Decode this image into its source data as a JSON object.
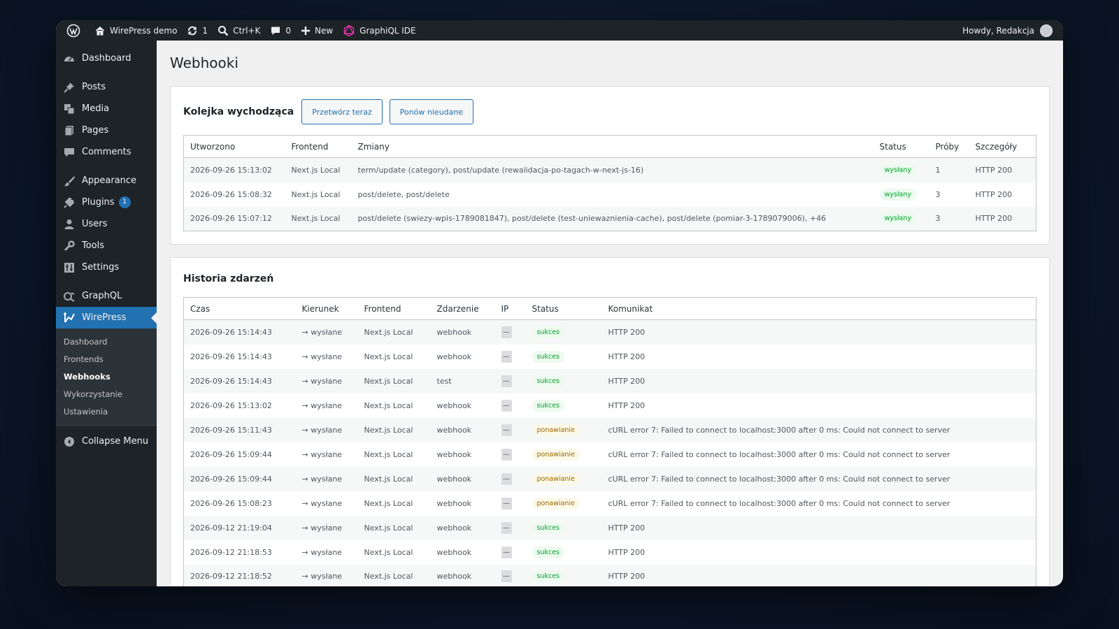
{
  "adminbar": {
    "site_name": "WirePress demo",
    "updates_count": "1",
    "search_shortcut": "Ctrl+K",
    "comments_count": "0",
    "new_label": "New",
    "graphiql_label": "GraphiQL IDE",
    "howdy": "Howdy, Redakcja"
  },
  "sidebar": {
    "items": [
      {
        "label": "Dashboard",
        "icon": "dashboard-icon"
      },
      {
        "label": "Posts",
        "icon": "pin-icon"
      },
      {
        "label": "Media",
        "icon": "media-icon"
      },
      {
        "label": "Pages",
        "icon": "pages-icon"
      },
      {
        "label": "Comments",
        "icon": "comment-icon"
      },
      {
        "label": "Appearance",
        "icon": "brush-icon"
      },
      {
        "label": "Plugins",
        "icon": "plugin-icon",
        "badge": "1"
      },
      {
        "label": "Users",
        "icon": "user-icon"
      },
      {
        "label": "Tools",
        "icon": "wrench-icon"
      },
      {
        "label": "Settings",
        "icon": "settings-icon"
      },
      {
        "label": "GraphQL",
        "icon": "graphql-icon"
      },
      {
        "label": "WirePress",
        "icon": "wirepress-icon"
      }
    ],
    "submenu": [
      "Dashboard",
      "Frontends",
      "Webhooks",
      "Wykorzystanie",
      "Ustawienia"
    ],
    "collapse_label": "Collapse Menu"
  },
  "page": {
    "title": "Webhooki"
  },
  "queue": {
    "title": "Kolejka wychodząca",
    "btn_process": "Przetwórz teraz",
    "btn_retry": "Ponów nieudane",
    "headers": [
      "Utworzono",
      "Frontend",
      "Zmiany",
      "Status",
      "Próby",
      "Szczegóły"
    ],
    "rows": [
      [
        "2026-09-26 15:13:02",
        "Next.js Local",
        "term/update (category), post/update (rewalidacja-po-tagach-w-next-js-16)",
        "wysłany",
        "1",
        "HTTP 200"
      ],
      [
        "2026-09-26 15:08:32",
        "Next.js Local",
        "post/delete, post/delete",
        "wysłany",
        "3",
        "HTTP 200"
      ],
      [
        "2026-09-26 15:07:12",
        "Next.js Local",
        "post/delete (swiezy-wpis-1789081847), post/delete (test-uniewaznienia-cache), post/delete (pomiar-3-1789079006), +46",
        "wysłany",
        "3",
        "HTTP 200"
      ]
    ]
  },
  "history": {
    "title": "Historia zdarzeń",
    "headers": [
      "Czas",
      "Kierunek",
      "Frontend",
      "Zdarzenie",
      "IP",
      "Status",
      "Komunikat"
    ],
    "rows": [
      [
        "2026-09-26 15:14:43",
        "→ wysłane",
        "Next.js Local",
        "webhook",
        "—",
        "sukces",
        "HTTP 200"
      ],
      [
        "2026-09-26 15:14:43",
        "→ wysłane",
        "Next.js Local",
        "webhook",
        "—",
        "sukces",
        "HTTP 200"
      ],
      [
        "2026-09-26 15:14:43",
        "→ wysłane",
        "Next.js Local",
        "test",
        "—",
        "sukces",
        "HTTP 200"
      ],
      [
        "2026-09-26 15:13:02",
        "→ wysłane",
        "Next.js Local",
        "webhook",
        "—",
        "sukces",
        "HTTP 200"
      ],
      [
        "2026-09-26 15:11:43",
        "→ wysłane",
        "Next.js Local",
        "webhook",
        "—",
        "ponawianie",
        "cURL error 7: Failed to connect to localhost:3000 after 0 ms: Could not connect to server"
      ],
      [
        "2026-09-26 15:09:44",
        "→ wysłane",
        "Next.js Local",
        "webhook",
        "—",
        "ponawianie",
        "cURL error 7: Failed to connect to localhost:3000 after 0 ms: Could not connect to server"
      ],
      [
        "2026-09-26 15:09:44",
        "→ wysłane",
        "Next.js Local",
        "webhook",
        "—",
        "ponawianie",
        "cURL error 7: Failed to connect to localhost:3000 after 0 ms: Could not connect to server"
      ],
      [
        "2026-09-26 15:08:23",
        "→ wysłane",
        "Next.js Local",
        "webhook",
        "—",
        "ponawianie",
        "cURL error 7: Failed to connect to localhost:3000 after 0 ms: Could not connect to server"
      ],
      [
        "2026-09-12 21:19:04",
        "→ wysłane",
        "Next.js Local",
        "webhook",
        "—",
        "sukces",
        "HTTP 200"
      ],
      [
        "2026-09-12 21:18:53",
        "→ wysłane",
        "Next.js Local",
        "webhook",
        "—",
        "sukces",
        "HTTP 200"
      ],
      [
        "2026-09-12 21:18:52",
        "→ wysłane",
        "Next.js Local",
        "webhook",
        "—",
        "sukces",
        "HTTP 200"
      ]
    ]
  },
  "colors": {
    "accent": "#2271b1",
    "sidebar_bg": "#1d2327",
    "success": "#00a32a",
    "retry": "#996800"
  }
}
